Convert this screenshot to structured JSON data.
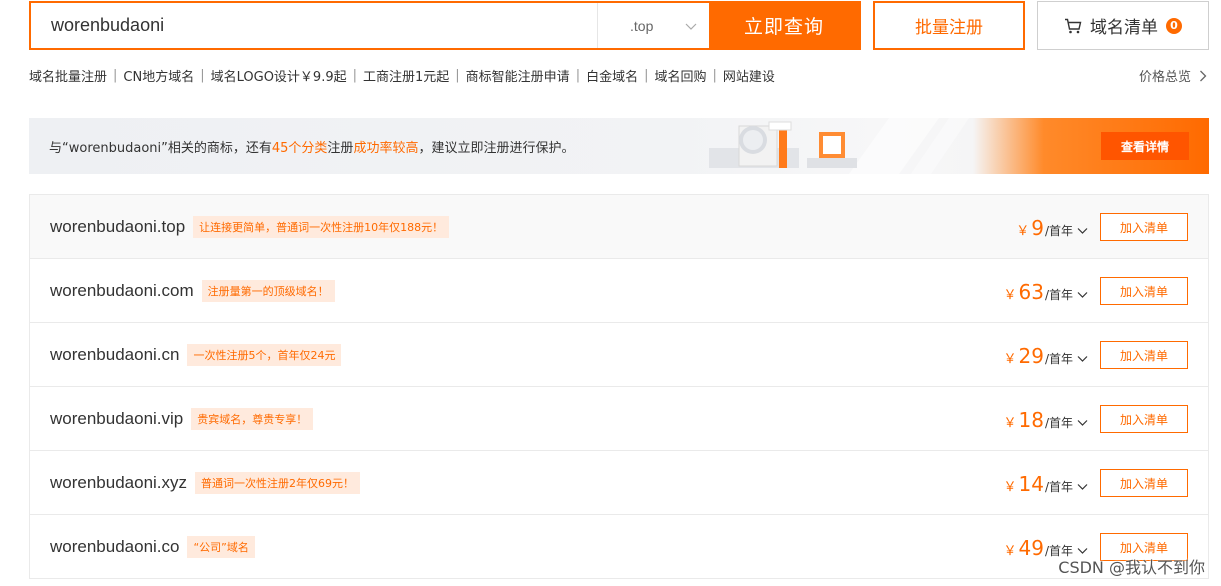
{
  "search": {
    "value": "worenbudaoni",
    "suffix": ".top",
    "search_button": "立即查询",
    "batch_button": "批量注册",
    "cart_label": "域名清单",
    "cart_count": "0"
  },
  "quick_links": [
    "域名批量注册",
    "CN地方域名",
    "域名LOGO设计￥9.9起",
    "工商注册1元起",
    "商标智能注册申请",
    "白金域名",
    "域名回购",
    "网站建设"
  ],
  "price_overview": "价格总览",
  "banner": {
    "text_before": "与“worenbudaoni”相关的商标，还有",
    "highlight1": "45个分类",
    "text_mid": "注册",
    "highlight2": "成功率较高",
    "text_after": "，建议立即注册进行保护。",
    "button": "查看详情"
  },
  "results": [
    {
      "domain": "worenbudaoni.top",
      "tag": "让连接更简单，普通词一次性注册10年仅188元！",
      "yen": "￥",
      "price": "9",
      "unit": "/首年",
      "button": "加入清单"
    },
    {
      "domain": "worenbudaoni.com",
      "tag": "注册量第一的顶级域名！",
      "yen": "￥",
      "price": "63",
      "unit": "/首年",
      "button": "加入清单"
    },
    {
      "domain": "worenbudaoni.cn",
      "tag": "一次性注册5个，首年仅24元",
      "yen": "￥",
      "price": "29",
      "unit": "/首年",
      "button": "加入清单"
    },
    {
      "domain": "worenbudaoni.vip",
      "tag": "贵宾域名，尊贵专享！",
      "yen": "￥",
      "price": "18",
      "unit": "/首年",
      "button": "加入清单"
    },
    {
      "domain": "worenbudaoni.xyz",
      "tag": "普通词一次性注册2年仅69元！",
      "yen": "￥",
      "price": "14",
      "unit": "/首年",
      "button": "加入清单"
    },
    {
      "domain": "worenbudaoni.co",
      "tag": "“公司”域名",
      "yen": "￥",
      "price": "49",
      "unit": "/首年",
      "button": "加入清单"
    }
  ],
  "watermark": "CSDN @我认不到你",
  "colors": {
    "accent": "#ff6a00",
    "tag_bg": "#ffeadd",
    "border": "#eaeaea"
  }
}
